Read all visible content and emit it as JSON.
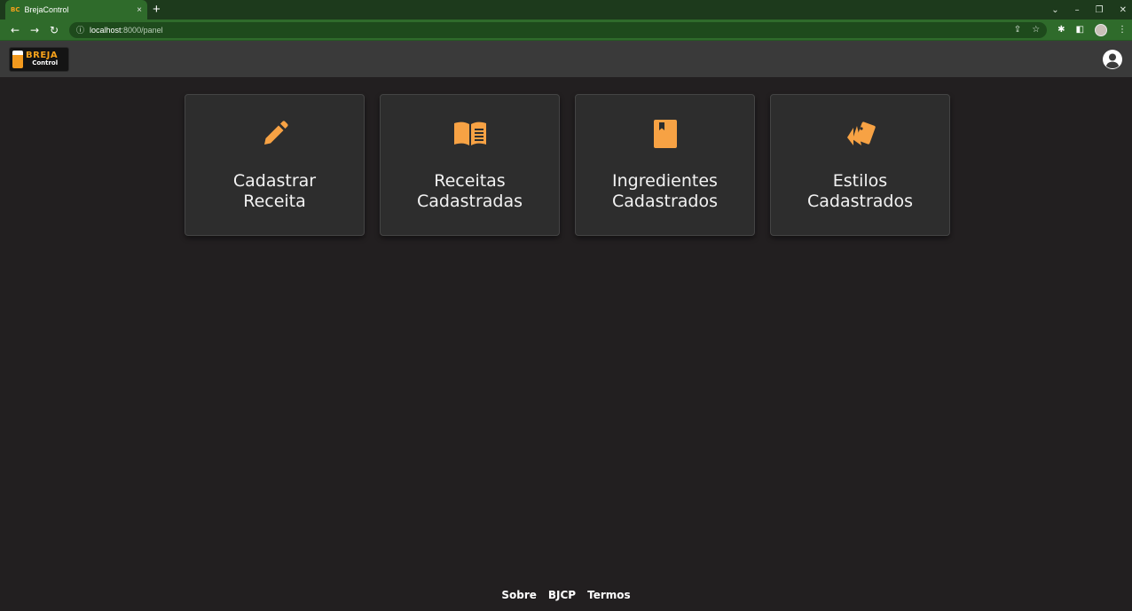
{
  "browser": {
    "tab_favicon": "BC",
    "tab_title": "BrejaControl",
    "tab_close": "×",
    "new_tab": "+",
    "url_host": "localhost",
    "url_path": ":8000/panel",
    "controls": {
      "dropdown": "⌄",
      "minimize": "–",
      "restore": "❐",
      "close": "✕"
    }
  },
  "appbar": {
    "logo_line1": "BREJA",
    "logo_line2": "Control"
  },
  "cards": [
    {
      "line1": "Cadastrar",
      "line2": "Receita",
      "icon": "pencil-icon"
    },
    {
      "line1": "Receitas",
      "line2": "Cadastradas",
      "icon": "book-open-icon"
    },
    {
      "line1": "Ingredientes",
      "line2": "Cadastrados",
      "icon": "book-icon"
    },
    {
      "line1": "Estilos",
      "line2": "Cadastrados",
      "icon": "swatches-icon"
    }
  ],
  "footer": {
    "links": [
      "Sobre",
      "BJCP",
      "Termos"
    ]
  },
  "colors": {
    "accent": "#f7a244",
    "background": "#221f20",
    "card": "#2d2d2d",
    "browser_green": "#2f6b2b"
  }
}
